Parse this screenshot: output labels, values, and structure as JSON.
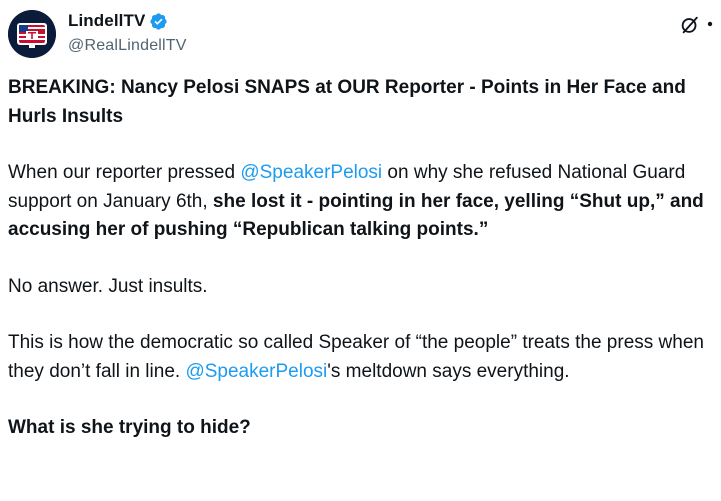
{
  "account": {
    "display_name": "LindellTV",
    "handle": "@RealLindellTV",
    "avatar_text": "LINDELL TV",
    "verified": true
  },
  "tweet": {
    "headline": "BREAKING: Nancy Pelosi SNAPS at OUR Reporter - Points in Her Face and Hurls Insults",
    "para1_a": "When our reporter pressed ",
    "para1_mention": "@SpeakerPelosi",
    "para1_b": " on why she refused National Guard support on January 6th, ",
    "para1_bold": "she lost it - pointing in her face, yelling “Shut up,” and accusing her of pushing “Republican talking points.”",
    "para2": "No answer. Just insults.",
    "para3_a": "This is how the democratic so called Speaker of “the people” treats the press when they don’t fall in line. ",
    "para3_mention": "@SpeakerPelosi",
    "para3_b": "'s meltdown says everything.",
    "closing": "What is she trying to hide?"
  },
  "colors": {
    "text": "#0f1419",
    "secondary": "#536471",
    "link": "#1d9bf0",
    "verified": "#1d9bf0"
  },
  "icons": {
    "verified": "verified-badge-icon",
    "grok": "grok-icon",
    "more": "more-icon"
  }
}
